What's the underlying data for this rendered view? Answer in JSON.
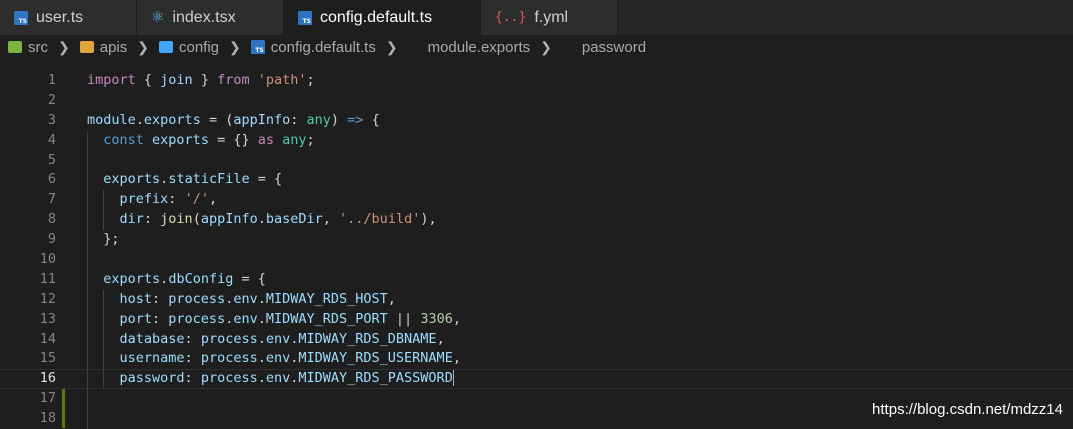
{
  "tabs": [
    {
      "label": "user.ts",
      "icon": "typescript-file-icon",
      "active": false
    },
    {
      "label": "index.tsx",
      "icon": "react-file-icon",
      "active": false
    },
    {
      "label": "config.default.ts",
      "icon": "typescript-file-icon",
      "active": true
    },
    {
      "label": "f.yml",
      "icon": "yaml-file-icon",
      "active": false
    }
  ],
  "breadcrumb": {
    "src": "src",
    "apis": "apis",
    "config": "config",
    "file": "config.default.ts",
    "symbol1": "module.exports",
    "symbol2": "password"
  },
  "editor": {
    "current_line": 16,
    "lines": [
      "1",
      "2",
      "3",
      "4",
      "5",
      "6",
      "7",
      "8",
      "9",
      "10",
      "11",
      "12",
      "13",
      "14",
      "15",
      "16",
      "17",
      "18"
    ],
    "code": {
      "l1": [
        "import",
        " { ",
        "join",
        " } ",
        "from",
        " ",
        "'path'",
        ";"
      ],
      "l3": [
        "module",
        ".",
        "exports",
        " = (",
        "appInfo",
        ": ",
        "any",
        ") ",
        "=>",
        " {"
      ],
      "l4": [
        "const",
        " ",
        "exports",
        " = {} ",
        "as",
        " ",
        "any",
        ";"
      ],
      "l6": [
        "exports",
        ".",
        "staticFile",
        " = {"
      ],
      "l7": [
        "prefix",
        ": ",
        "'/'",
        ","
      ],
      "l8": [
        "dir",
        ": ",
        "join",
        "(",
        "appInfo",
        ".",
        "baseDir",
        ", ",
        "'../build'",
        "),"
      ],
      "l9": [
        "};"
      ],
      "l11": [
        "exports",
        ".",
        "dbConfig",
        " = {"
      ],
      "l12": [
        "host",
        ": ",
        "process",
        ".",
        "env",
        ".",
        "MIDWAY_RDS_HOST",
        ","
      ],
      "l13": [
        "port",
        ": ",
        "process",
        ".",
        "env",
        ".",
        "MIDWAY_RDS_PORT",
        " || ",
        "3306",
        ","
      ],
      "l14": [
        "database",
        ": ",
        "process",
        ".",
        "env",
        ".",
        "MIDWAY_RDS_DBNAME",
        ","
      ],
      "l15": [
        "username",
        ": ",
        "process",
        ".",
        "env",
        ".",
        "MIDWAY_RDS_USERNAME",
        ","
      ],
      "l16": [
        "password",
        ": ",
        "process",
        ".",
        "env",
        ".",
        "MIDWAY_RDS_PASSWORD"
      ]
    }
  },
  "watermark": "https://blog.csdn.net/mdzz14",
  "colors": {
    "keyword": "#c586c0",
    "variable": "#9cdcfe",
    "function": "#dcdcaa",
    "string": "#ce9178",
    "number": "#b5cea8",
    "diff_added": "#587c0c"
  }
}
